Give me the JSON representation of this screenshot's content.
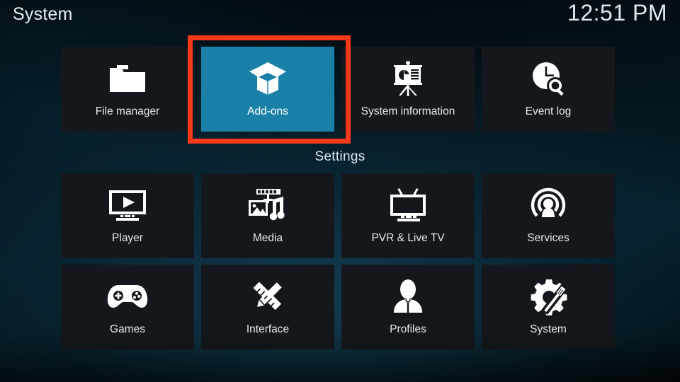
{
  "header": {
    "title": "System",
    "clock": "12:51 PM"
  },
  "section": {
    "settings_label": "Settings"
  },
  "theme": {
    "background_dark": "#03080c",
    "background_teal": "#062230",
    "tile_bg": "#14181c",
    "tile_selected_bg": "#1a80a8",
    "text_color": "#e3eaef",
    "annotation_border": "#f5391a"
  },
  "rows": {
    "top": [
      {
        "label": "File manager",
        "icon": "folder-icon",
        "selected": false
      },
      {
        "label": "Add-ons",
        "icon": "open-box-icon",
        "selected": true
      },
      {
        "label": "System information",
        "icon": "presentation-icon",
        "selected": false
      },
      {
        "label": "Event log",
        "icon": "clock-search-icon",
        "selected": false
      }
    ],
    "middle": [
      {
        "label": "Player",
        "icon": "monitor-play-icon",
        "selected": false
      },
      {
        "label": "Media",
        "icon": "media-collage-icon",
        "selected": false
      },
      {
        "label": "PVR & Live TV",
        "icon": "tv-antenna-icon",
        "selected": false
      },
      {
        "label": "Services",
        "icon": "broadcast-icon",
        "selected": false
      }
    ],
    "bottom": [
      {
        "label": "Games",
        "icon": "gamepad-icon",
        "selected": false
      },
      {
        "label": "Interface",
        "icon": "pencil-ruler-icon",
        "selected": false
      },
      {
        "label": "Profiles",
        "icon": "person-icon",
        "selected": false
      },
      {
        "label": "System",
        "icon": "gear-tool-icon",
        "selected": false
      }
    ]
  },
  "annotation": {
    "target": "Add-ons",
    "shape": "rectangle-highlight"
  }
}
